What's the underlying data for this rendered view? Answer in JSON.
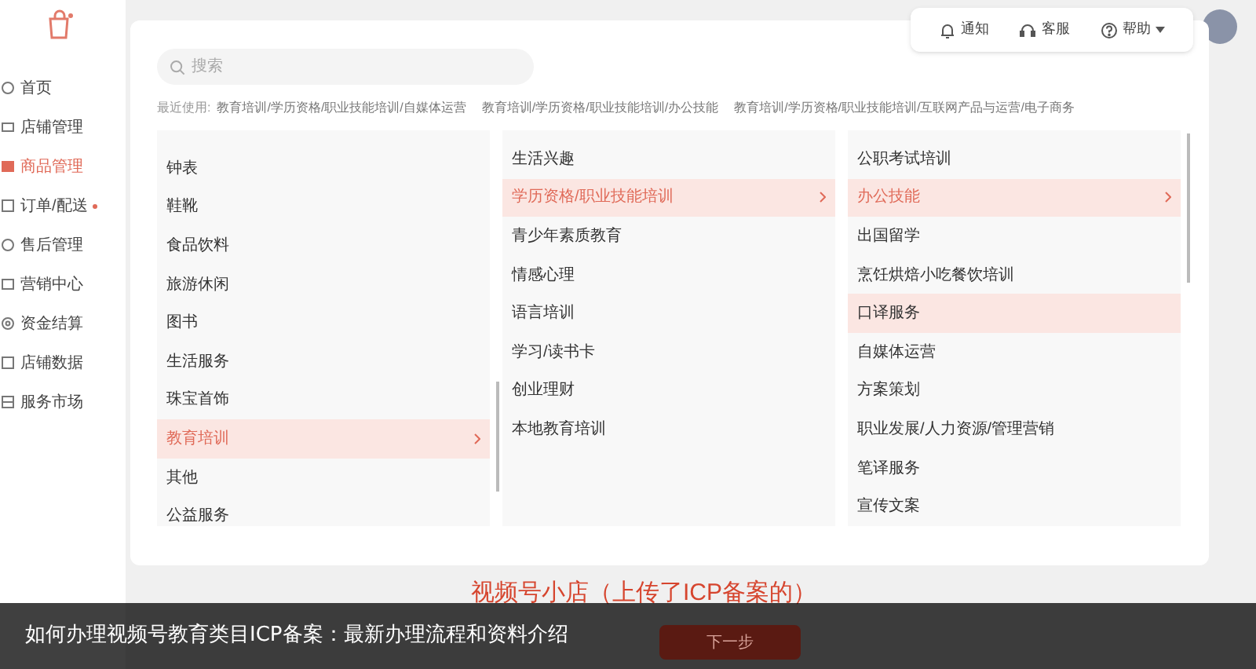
{
  "sidebar": {
    "items": [
      {
        "label": "首页",
        "selected": false,
        "badge": false
      },
      {
        "label": "店铺管理",
        "selected": false,
        "badge": false
      },
      {
        "label": "商品管理",
        "selected": true,
        "badge": false
      },
      {
        "label": "订单/配送",
        "selected": false,
        "badge": true
      },
      {
        "label": "售后管理",
        "selected": false,
        "badge": false
      },
      {
        "label": "营销中心",
        "selected": false,
        "badge": false
      },
      {
        "label": "资金结算",
        "selected": false,
        "badge": false
      },
      {
        "label": "店铺数据",
        "selected": false,
        "badge": false
      },
      {
        "label": "服务市场",
        "selected": false,
        "badge": false
      }
    ]
  },
  "toolbar": {
    "items": [
      {
        "kind": "bell",
        "label": "通知"
      },
      {
        "kind": "headset",
        "label": "客服"
      },
      {
        "kind": "help",
        "label": "帮助"
      }
    ]
  },
  "search": {
    "placeholder": "搜索"
  },
  "recent": {
    "label": "最近使用:",
    "items": [
      "教育培训/学历资格/职业技能培训/自媒体运营",
      "教育培训/学历资格/职业技能培训/办公技能",
      "教育培训/学历资格/职业技能培训/互联网产品与运营/电子商务"
    ]
  },
  "columns": [
    {
      "items": [
        {
          "label": "钟表",
          "selected": false,
          "highlighted": false
        },
        {
          "label": "鞋靴",
          "selected": false,
          "highlighted": false
        },
        {
          "label": "食品饮料",
          "selected": false,
          "highlighted": false
        },
        {
          "label": "旅游休闲",
          "selected": false,
          "highlighted": false
        },
        {
          "label": "图书",
          "selected": false,
          "highlighted": false
        },
        {
          "label": "生活服务",
          "selected": false,
          "highlighted": false
        },
        {
          "label": "珠宝首饰",
          "selected": false,
          "highlighted": false
        },
        {
          "label": "教育培训",
          "selected": true,
          "highlighted": false
        },
        {
          "label": "其他",
          "selected": false,
          "highlighted": false
        },
        {
          "label": "公益服务",
          "selected": false,
          "highlighted": false
        }
      ]
    },
    {
      "items": [
        {
          "label": "生活兴趣",
          "selected": false,
          "highlighted": false
        },
        {
          "label": "学历资格/职业技能培训",
          "selected": true,
          "highlighted": false
        },
        {
          "label": "青少年素质教育",
          "selected": false,
          "highlighted": false
        },
        {
          "label": "情感心理",
          "selected": false,
          "highlighted": false
        },
        {
          "label": "语言培训",
          "selected": false,
          "highlighted": false
        },
        {
          "label": "学习/读书卡",
          "selected": false,
          "highlighted": false
        },
        {
          "label": "创业理财",
          "selected": false,
          "highlighted": false
        },
        {
          "label": "本地教育培训",
          "selected": false,
          "highlighted": false
        }
      ]
    },
    {
      "items": [
        {
          "label": "公职考试培训",
          "selected": false,
          "highlighted": false
        },
        {
          "label": "办公技能",
          "selected": true,
          "highlighted": false
        },
        {
          "label": "出国留学",
          "selected": false,
          "highlighted": false
        },
        {
          "label": "烹饪烘焙小吃餐饮培训",
          "selected": false,
          "highlighted": false
        },
        {
          "label": "口译服务",
          "selected": false,
          "highlighted": true
        },
        {
          "label": "自媒体运营",
          "selected": false,
          "highlighted": false
        },
        {
          "label": "方案策划",
          "selected": false,
          "highlighted": false
        },
        {
          "label": "职业发展/人力资源/管理营销",
          "selected": false,
          "highlighted": false
        },
        {
          "label": "笔译服务",
          "selected": false,
          "highlighted": false
        },
        {
          "label": "宣传文案",
          "selected": false,
          "highlighted": false
        }
      ]
    }
  ],
  "overlay_title": "视频号小店（上传了ICP备案的）",
  "next_button": "下一步",
  "caption": "如何办理视频号教育类目ICP备案：最新办理流程和资料介绍"
}
